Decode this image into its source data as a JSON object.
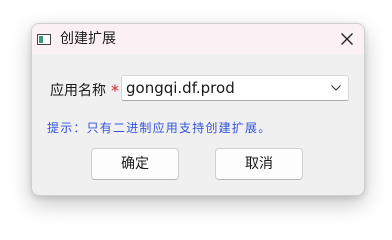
{
  "window": {
    "title": "创建扩展",
    "app_icon": "app-window-icon",
    "close_icon": "close-icon"
  },
  "form": {
    "app_name_label": "应用名称",
    "required_mark": "*",
    "app_name_value": "gongqi.df.prod",
    "dropdown_icon": "chevron-down-icon"
  },
  "hint": {
    "text": "提示：只有二进制应用支持创建扩展。"
  },
  "buttons": {
    "ok_label": "确定",
    "cancel_label": "取消"
  },
  "colors": {
    "hint_text": "#3355dd",
    "required_mark": "#e02020",
    "titlebar_bg": "#fbf1f4",
    "dialog_bg": "#f0f0f0"
  }
}
